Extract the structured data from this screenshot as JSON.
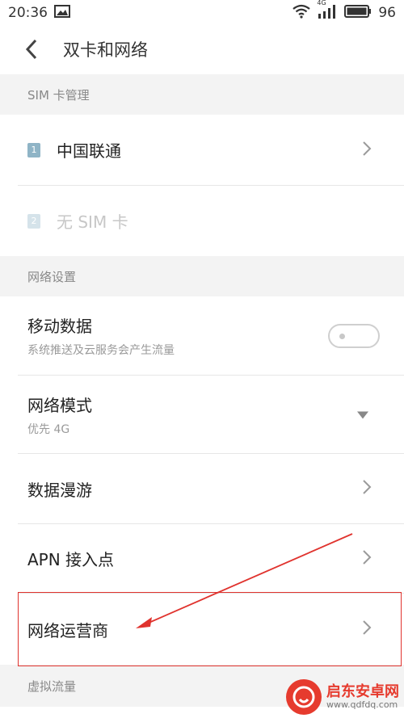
{
  "status_bar": {
    "time": "20:36",
    "battery": "96",
    "network_type": "4G",
    "icons": [
      "image-icon",
      "wifi-icon",
      "signal-icon",
      "battery-icon"
    ]
  },
  "app_bar": {
    "title": "双卡和网络"
  },
  "sim_section": {
    "header": "SIM 卡管理",
    "sim1": {
      "index": "1",
      "label": "中国联通"
    },
    "sim2": {
      "index": "2",
      "label": "无 SIM 卡"
    }
  },
  "network_section": {
    "header": "网络设置",
    "mobile_data": {
      "label": "移动数据",
      "sub": "系统推送及云服务会产生流量",
      "enabled": false
    },
    "network_mode": {
      "label": "网络模式",
      "sub": "优先 4G"
    },
    "roaming": {
      "label": "数据漫游"
    },
    "apn": {
      "label": "APN 接入点"
    },
    "operator": {
      "label": "网络运营商"
    }
  },
  "virtual_section": {
    "header": "虚拟流量"
  },
  "watermark": {
    "title": "启东安卓网",
    "url": "www.qdfdq.com"
  },
  "colors": {
    "accent": "#e0332e",
    "sim_badge": "#8fb4c6",
    "section_bg": "#f3f3f3"
  }
}
